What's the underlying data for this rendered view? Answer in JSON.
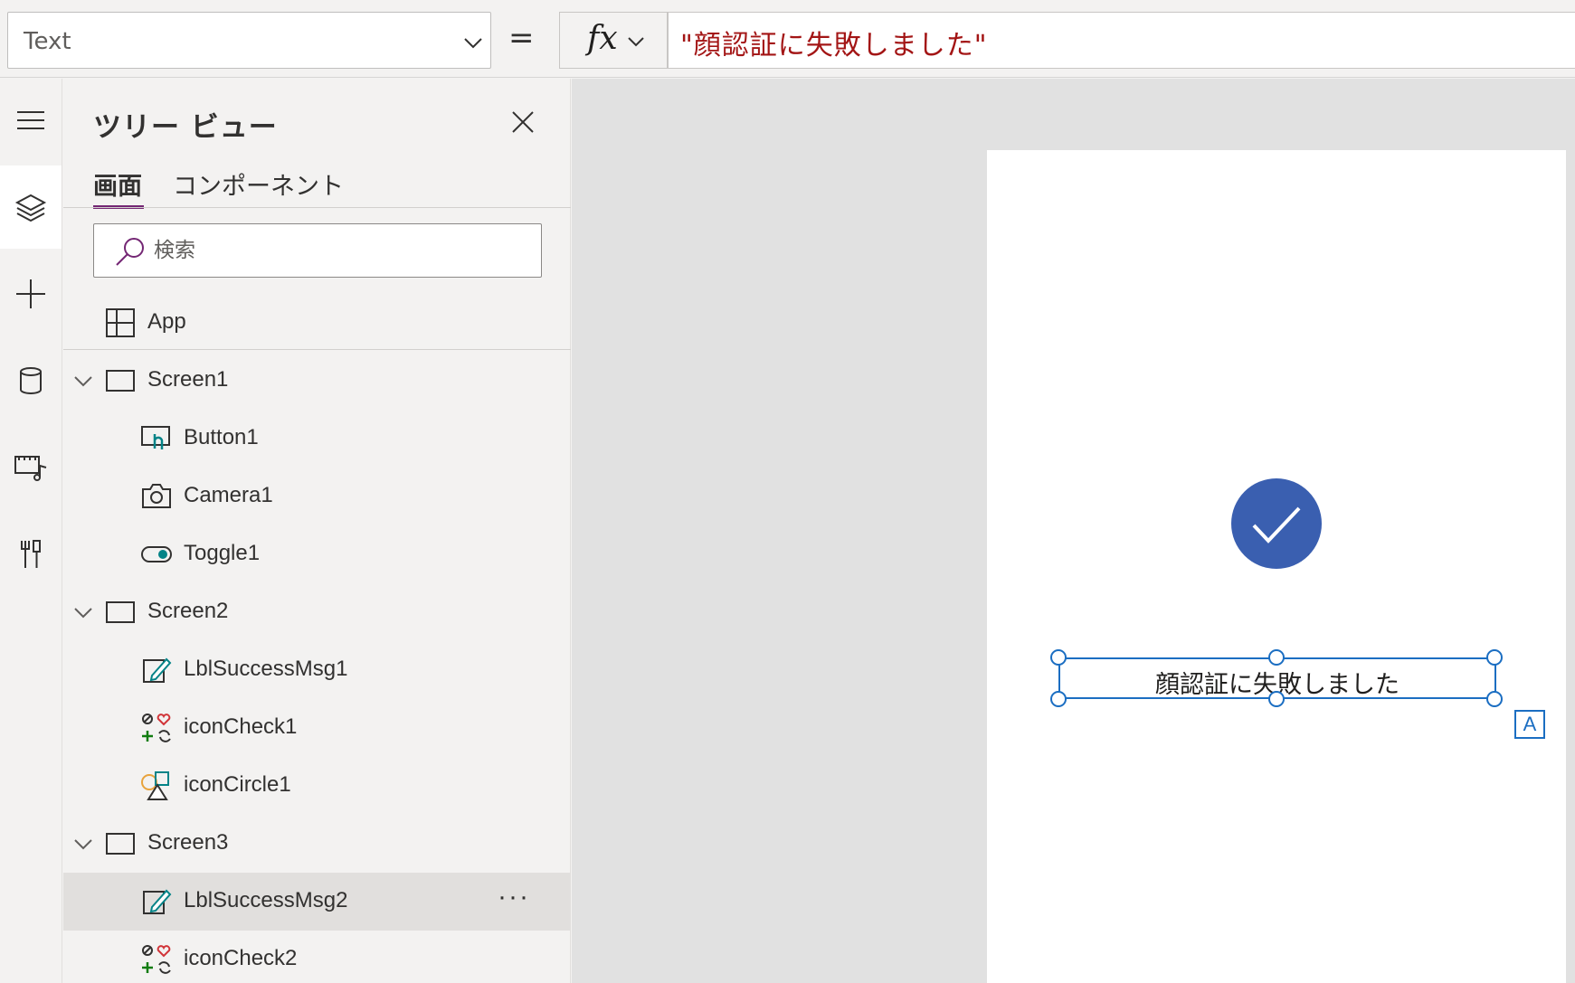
{
  "formula_bar": {
    "property": "Text",
    "equals": "=",
    "fx_label": "fx",
    "formula": "\"顔認証に失敗しました\""
  },
  "left_rail": {
    "icons": [
      "hamburger-icon",
      "layers-icon",
      "plus-icon",
      "database-icon",
      "media-icon",
      "tools-icon"
    ],
    "active": "layers-icon"
  },
  "tree_view": {
    "title": "ツリー ビュー",
    "tabs": [
      {
        "label": "画面",
        "active": true
      },
      {
        "label": "コンポーネント",
        "active": false
      }
    ],
    "search_placeholder": "検索",
    "app_label": "App",
    "items": [
      {
        "label": "Screen1",
        "type": "screen",
        "expanded": true
      },
      {
        "label": "Button1",
        "type": "button"
      },
      {
        "label": "Camera1",
        "type": "camera"
      },
      {
        "label": "Toggle1",
        "type": "toggle"
      },
      {
        "label": "Screen2",
        "type": "screen",
        "expanded": true
      },
      {
        "label": "LblSuccessMsg1",
        "type": "label"
      },
      {
        "label": "iconCheck1",
        "type": "icon"
      },
      {
        "label": "iconCircle1",
        "type": "shape"
      },
      {
        "label": "Screen3",
        "type": "screen",
        "expanded": true
      },
      {
        "label": "LblSuccessMsg2",
        "type": "label",
        "selected": true
      },
      {
        "label": "iconCheck2",
        "type": "icon"
      }
    ],
    "more_label": "···"
  },
  "canvas": {
    "label_text": "顔認証に失敗しました",
    "badge_letter": "A",
    "check_color": "#3a5fb0",
    "selection_color": "#1b6ec2"
  },
  "colors": {
    "accent": "#742774",
    "formula_text": "#a31515"
  }
}
